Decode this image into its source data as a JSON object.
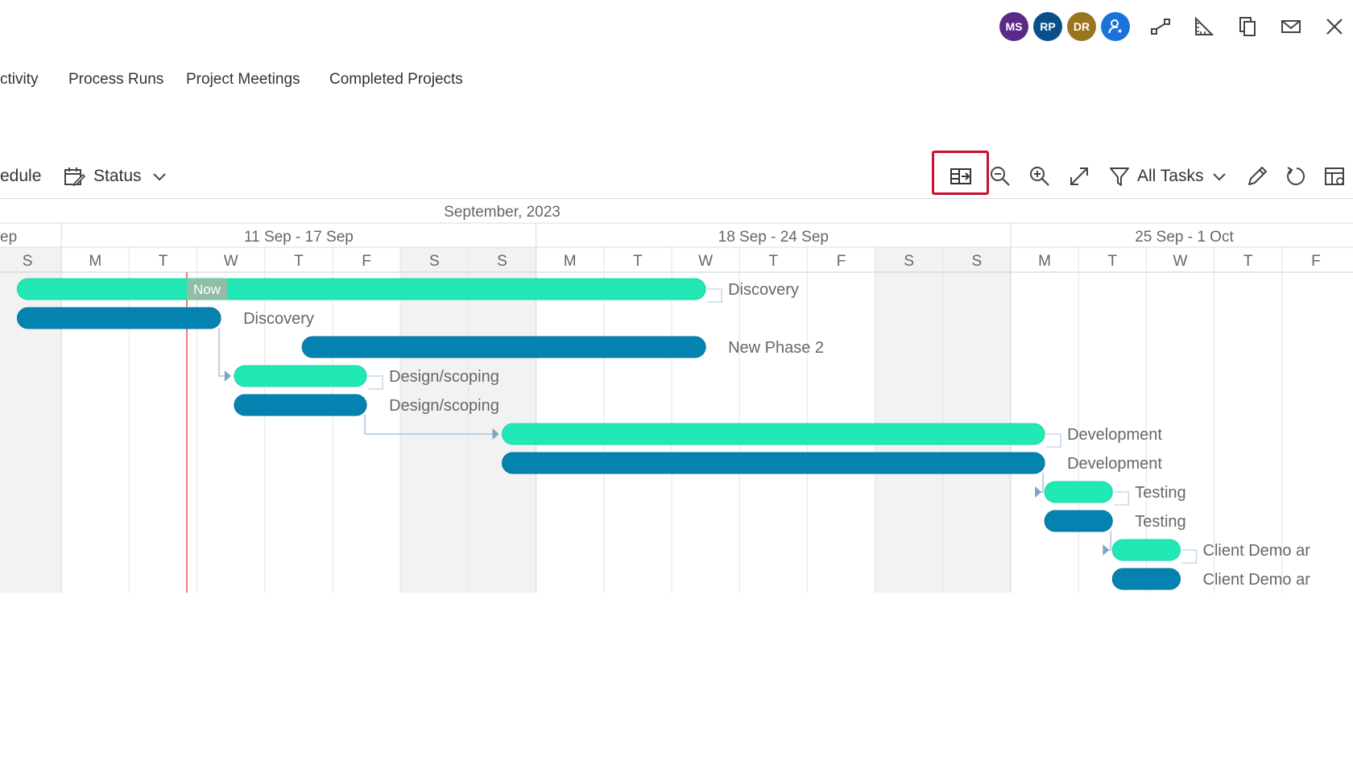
{
  "header": {
    "avatars": [
      {
        "initials": "MS",
        "color": "#5b2a86"
      },
      {
        "initials": "RP",
        "color": "#0b4f8a"
      },
      {
        "initials": "DR",
        "color": "#9a7520"
      },
      {
        "initials": "",
        "color": "#1a73d9",
        "icon": "user-icon"
      }
    ],
    "icons": [
      "link-icon",
      "ruler-icon",
      "copy-icon",
      "mail-icon",
      "close-icon"
    ]
  },
  "tabs": [
    "ctivity",
    "Process Runs",
    "Project Meetings",
    "Completed Projects"
  ],
  "toolbar": {
    "schedule_label": "edule",
    "status_label": "Status",
    "filter_label": "All Tasks",
    "icons": [
      "task-panel-icon",
      "zoom-out-icon",
      "zoom-in-icon",
      "expand-icon",
      "filter-icon",
      "edit-icon",
      "refresh-icon",
      "column-settings-icon"
    ]
  },
  "gantt": {
    "month": "September, 2023",
    "weeks": [
      "ep",
      "11 Sep - 17 Sep",
      "18 Sep - 24 Sep",
      "25 Sep - 1 Oct"
    ],
    "days": [
      "S",
      "M",
      "T",
      "W",
      "T",
      "F",
      "S",
      "S",
      "M",
      "T",
      "W",
      "T",
      "F",
      "S",
      "S",
      "M",
      "T",
      "W",
      "T",
      "F"
    ],
    "weekend_days": [
      0,
      6,
      7,
      13,
      14
    ],
    "now_label": "Now",
    "now_day": 2.85,
    "colors": {
      "baseline": "#22e8b5",
      "actual": "#0583b0",
      "now": "#f07a7a"
    },
    "tasks": [
      {
        "label": "Discovery",
        "kind": "baseline",
        "start": 0.35,
        "end": 10.5
      },
      {
        "label": "Discovery",
        "kind": "actual",
        "start": 0.35,
        "end": 3.35
      },
      {
        "label": "New Phase 2",
        "kind": "actual",
        "start": 4.55,
        "end": 10.5
      },
      {
        "label": "Design/scoping",
        "kind": "baseline",
        "start": 3.55,
        "end": 5.5
      },
      {
        "label": "Design/scoping",
        "kind": "actual",
        "start": 3.55,
        "end": 5.5
      },
      {
        "label": "Development",
        "kind": "baseline",
        "start": 7.5,
        "end": 15.5
      },
      {
        "label": "Development",
        "kind": "actual",
        "start": 7.5,
        "end": 15.5
      },
      {
        "label": "Testing",
        "kind": "baseline",
        "start": 15.5,
        "end": 16.5
      },
      {
        "label": "Testing",
        "kind": "actual",
        "start": 15.5,
        "end": 16.5
      },
      {
        "label": "Client Demo ar",
        "kind": "baseline",
        "start": 16.5,
        "end": 17.5
      },
      {
        "label": "Client Demo ar",
        "kind": "actual",
        "start": 16.5,
        "end": 17.5
      }
    ],
    "dependencies": [
      [
        1,
        3
      ],
      [
        4,
        5
      ],
      [
        6,
        7
      ],
      [
        8,
        9
      ]
    ]
  }
}
